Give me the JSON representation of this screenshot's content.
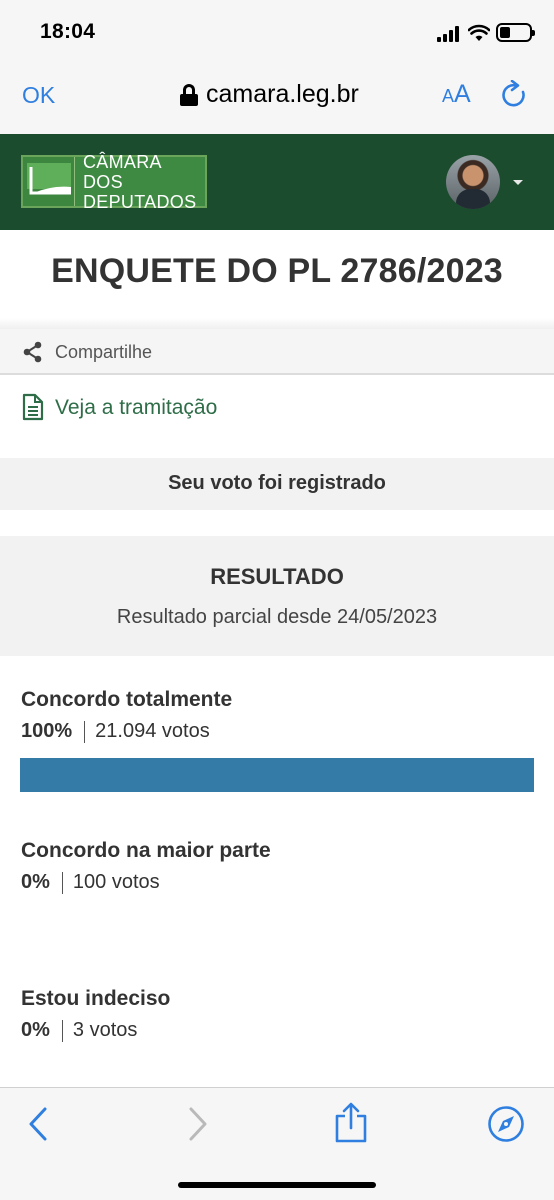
{
  "status_bar": {
    "time": "18:04"
  },
  "browser": {
    "ok_label": "OK",
    "url": "camara.leg.br",
    "aa_small": "A",
    "aa_big": "A"
  },
  "site": {
    "logo_line1": "CÂMARA DOS",
    "logo_line2": "DEPUTADOS",
    "header_color": "#1c4c2e"
  },
  "page": {
    "title": "ENQUETE DO PL 2786/2023",
    "share_label": "Compartilhe",
    "tramitacao_label": "Veja a tramitação",
    "registered_msg": "Seu voto foi registrado"
  },
  "result": {
    "title": "RESULTADO",
    "subtitle": "Resultado parcial desde 24/05/2023",
    "options": [
      {
        "name": "Concordo totalmente",
        "percent": "100%",
        "votes": "21.094 votos",
        "fraction": 1.0
      },
      {
        "name": "Concordo na maior parte",
        "percent": "0%",
        "votes": "100 votos",
        "fraction": 0.0
      },
      {
        "name": "Estou indeciso",
        "percent": "0%",
        "votes": "3 votos",
        "fraction": 0.0
      }
    ],
    "bar_color": "#347ca7"
  },
  "toolbar": {
    "icons": [
      "back-icon",
      "forward-icon",
      "share-icon",
      "compass-icon"
    ]
  },
  "colors": {
    "accent": "#2f7fe0",
    "link_green": "#2e6d48"
  }
}
